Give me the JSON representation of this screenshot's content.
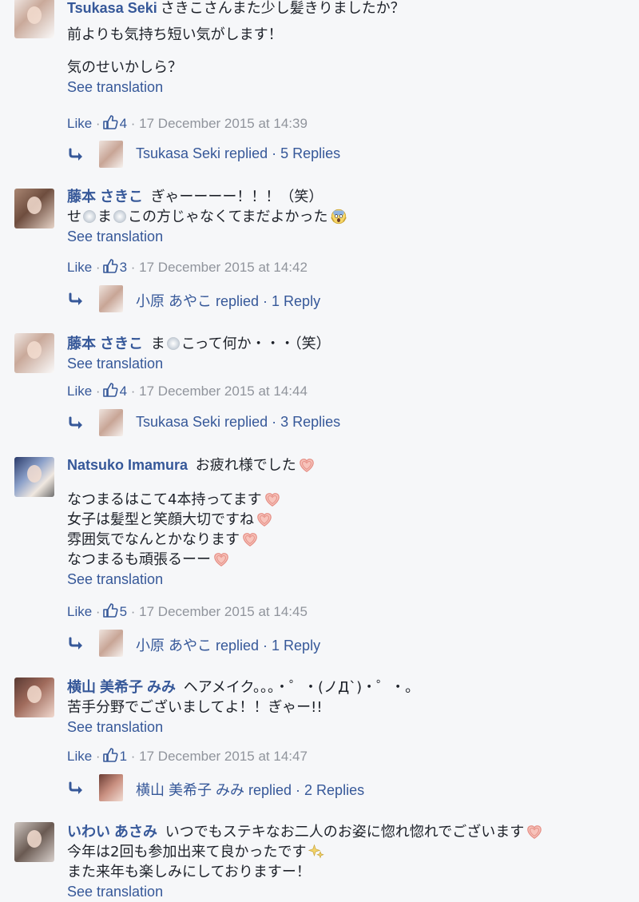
{
  "comments": [
    {
      "name": "Tsukasa Seki",
      "lines": [
        "さきこさんまた少し髪きりましたか？",
        "前よりも気持ち短い気がします！",
        "気のせいかしら？"
      ],
      "see_translation": "See translation",
      "like": "Like",
      "like_count": "4",
      "date": "17 December 2015 at 14:39",
      "reply_text": "Tsukasa Seki replied · 5 Replies"
    },
    {
      "name": "藤本 さきこ",
      "lines": [
        "ぎゃーーーー！！！（笑）",
        "せ",
        "ま",
        "この方じゃなくてまだよかった"
      ],
      "see_translation": "See translation",
      "like": "Like",
      "like_count": "3",
      "date": "17 December 2015 at 14:42",
      "reply_text": "小原 あやこ replied · 1 Reply"
    },
    {
      "name": "藤本 さきこ",
      "lines": [
        "ま",
        "こって何か・・・（笑）"
      ],
      "see_translation": "See translation",
      "like": "Like",
      "like_count": "4",
      "date": "17 December 2015 at 14:44",
      "reply_text": "Tsukasa Seki replied · 3 Replies"
    },
    {
      "name": "Natsuko Imamura",
      "lines": [
        "お疲れ様でした",
        "なつまるはこて4本持ってます",
        "女子は髪型と笑顔大切ですね",
        "雰囲気でなんとかなります",
        "なつまるも頑張るーー"
      ],
      "see_translation": "See translation",
      "like": "Like",
      "like_count": "5",
      "date": "17 December 2015 at 14:45",
      "reply_text": "小原 あやこ replied · 1 Reply"
    },
    {
      "name": "横山 美希子 みみ",
      "lines": [
        "ヘアメイク。。。・゜・(ノД`)・゜・。",
        "苦手分野でございましてよ！！ぎゃー!!"
      ],
      "see_translation": "See translation",
      "like": "Like",
      "like_count": "1",
      "date": "17 December 2015 at 14:47",
      "reply_text": "横山 美希子 みみ replied · 2 Replies"
    },
    {
      "name": "いわい あさみ",
      "lines": [
        "いつでもステキなお二人のお姿に惚れ惚れでございます",
        "今年は2回も参加出来て良かったです",
        "また来年も楽しみにしておりますー！"
      ],
      "see_translation": "See translation"
    }
  ],
  "icons": {
    "thumb": "thumbs-up-icon",
    "reply_arrow": "reply-arrow-icon",
    "heart": "heart-emoji-icon",
    "scream": "scream-emoji-icon",
    "sparkle": "sparkles-emoji-icon",
    "blank": "blank-emoji-icon"
  },
  "colors": {
    "link": "#365899",
    "meta": "#90949c",
    "text": "#1d2129",
    "background": "#f6f7f9",
    "heart": "#f4a9a0"
  }
}
